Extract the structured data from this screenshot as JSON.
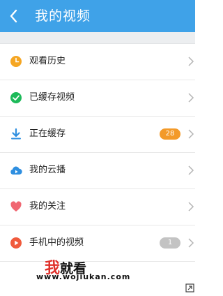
{
  "header": {
    "title": "我的视频",
    "color": "#3fa2e8"
  },
  "menu": {
    "items": [
      {
        "label": "观看历史",
        "icon": "clock-icon",
        "color": "#f5a623",
        "badge": null
      },
      {
        "label": "已缓存视频",
        "icon": "check-circle-icon",
        "color": "#1dba5a",
        "badge": null
      },
      {
        "label": "正在缓存",
        "icon": "download-icon",
        "color": "#2f8fe0",
        "badge": "28"
      },
      {
        "label": "我的云播",
        "icon": "cloud-play-icon",
        "color": "#2f8fe0",
        "badge": null
      },
      {
        "label": "我的关注",
        "icon": "heart-icon",
        "color": "#f06772",
        "badge": null
      },
      {
        "label": "手机中的视频",
        "icon": "play-circle-icon",
        "color": "#f05a3c",
        "badge": "1"
      }
    ]
  },
  "watermark": {
    "text_first": "我",
    "text_rest": "就看",
    "url": "www.wojiukan.com"
  }
}
